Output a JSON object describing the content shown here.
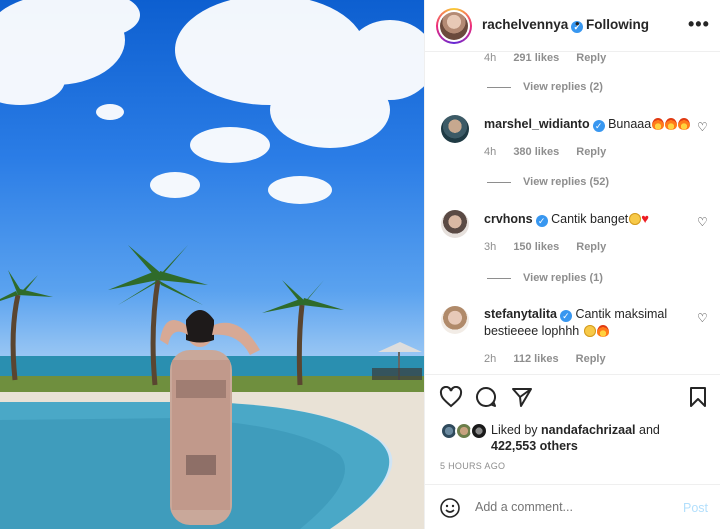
{
  "header": {
    "username": "rachelvennya",
    "verified_mark": "✓",
    "separator": "•",
    "follow_status": "Following",
    "more_icon": "more-horizontal-icon"
  },
  "comments": {
    "top_meta": {
      "time": "4h",
      "likes": "291 likes",
      "reply": "Reply"
    },
    "top_view_replies": "View replies (2)",
    "items": [
      {
        "username": "marshel_widianto",
        "text": "Bunaaa",
        "emojis": [
          "fire",
          "fire",
          "fire"
        ],
        "time": "4h",
        "likes": "380 likes",
        "reply": "Reply",
        "view_replies": "View replies (52)"
      },
      {
        "username": "crvhons",
        "text": "Cantik banget",
        "emojis": [
          "smiling-face",
          "red-heart"
        ],
        "time": "3h",
        "likes": "150 likes",
        "reply": "Reply",
        "view_replies": "View replies (1)"
      },
      {
        "username": "stefanytalita",
        "text": "Cantik maksimal bestieeee lophhh",
        "emojis": [
          "heart-eyes",
          "fire"
        ],
        "time": "2h",
        "likes": "112 likes",
        "reply": "Reply"
      }
    ]
  },
  "actions": {
    "icons": [
      "heart-icon",
      "comment-icon",
      "share-icon",
      "bookmark-icon"
    ],
    "liked_by_prefix": "Liked by",
    "liked_by_user": "nandafachrizaal",
    "liked_by_and": "and",
    "others_count": "422,553 others",
    "timestamp": "5 HOURS AGO"
  },
  "add_comment": {
    "placeholder": "Add a comment...",
    "post_label": "Post",
    "emoji_icon": "smiley-icon"
  },
  "colors": {
    "verified": "#3897f0",
    "post_disabled": "#b2dffc",
    "muted_text": "#8e8e8e"
  }
}
